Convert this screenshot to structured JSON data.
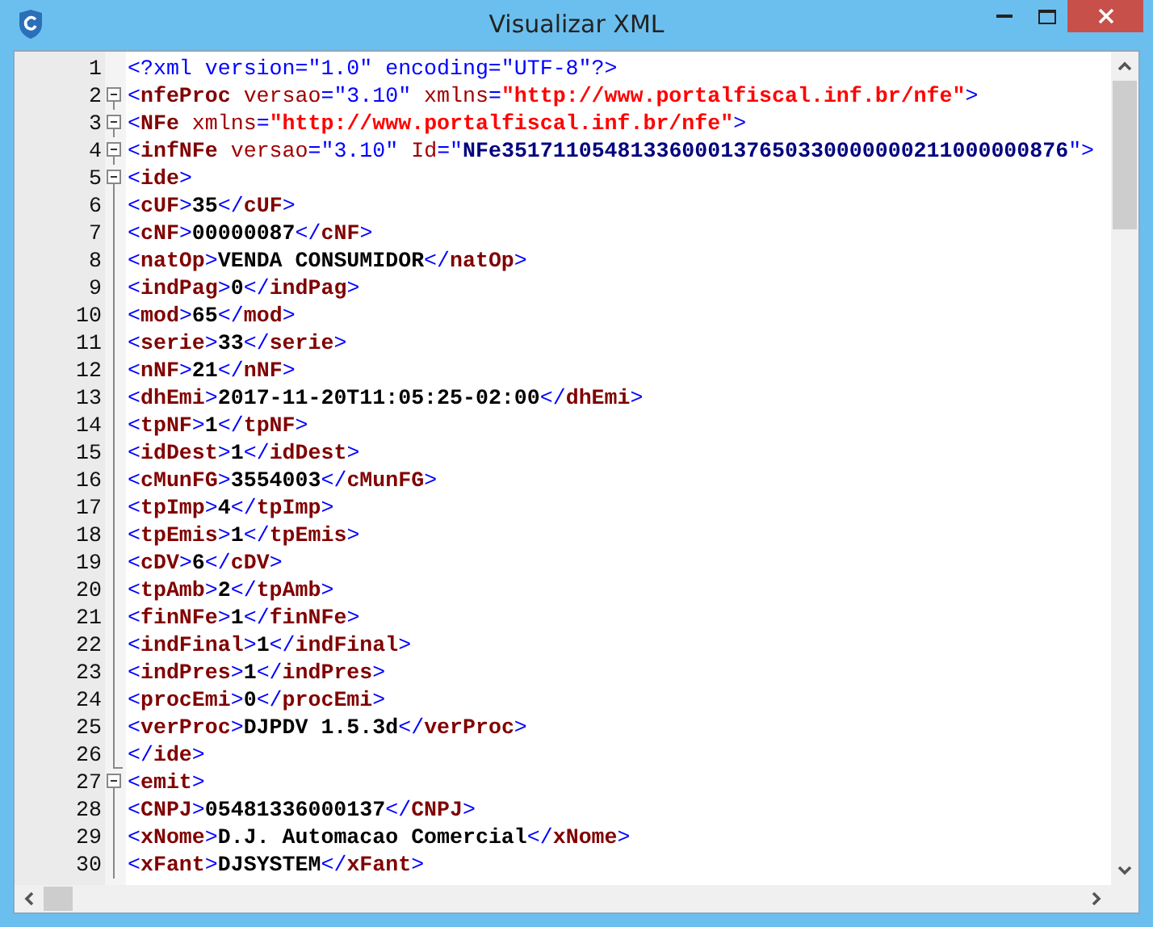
{
  "window": {
    "title": "Visualizar XML",
    "buttons": [
      {
        "kind": "minimize"
      },
      {
        "kind": "maximize"
      },
      {
        "kind": "close"
      }
    ]
  },
  "editor": {
    "lines": [
      {
        "number": "1",
        "kind": "plain",
        "tokens": [
          {
            "kind": "punct",
            "text": "<?xml version=\"1.0\" encoding=\"UTF-8\"?>"
          }
        ]
      },
      {
        "number": "2",
        "kind": "fold",
        "tokens": [
          {
            "kind": "punct",
            "text": "<"
          },
          {
            "kind": "tag",
            "text": "nfeProc"
          },
          {
            "kind": "attr",
            "text": " versao"
          },
          {
            "kind": "punct",
            "text": "="
          },
          {
            "kind": "value",
            "text": "\"3.10\""
          },
          {
            "kind": "attr",
            "text": " xmlns"
          },
          {
            "kind": "punct",
            "text": "="
          },
          {
            "kind": "url",
            "text": "\"http://www.portalfiscal.inf.br/nfe\""
          },
          {
            "kind": "punct",
            "text": ">"
          }
        ]
      },
      {
        "number": "3",
        "kind": "fold",
        "tokens": [
          {
            "kind": "punct",
            "text": "<"
          },
          {
            "kind": "tag",
            "text": "NFe"
          },
          {
            "kind": "attr",
            "text": " xmlns"
          },
          {
            "kind": "punct",
            "text": "="
          },
          {
            "kind": "url",
            "text": "\"http://www.portalfiscal.inf.br/nfe\""
          },
          {
            "kind": "punct",
            "text": ">"
          }
        ]
      },
      {
        "number": "4",
        "kind": "fold",
        "tokens": [
          {
            "kind": "punct",
            "text": "<"
          },
          {
            "kind": "tag",
            "text": "infNFe"
          },
          {
            "kind": "attr",
            "text": " versao"
          },
          {
            "kind": "punct",
            "text": "="
          },
          {
            "kind": "value",
            "text": "\"3.10\""
          },
          {
            "kind": "attr",
            "text": " Id"
          },
          {
            "kind": "punct",
            "text": "=\""
          },
          {
            "kind": "id",
            "text": "NFe35171105481336000137650330000000211000000876"
          },
          {
            "kind": "punct",
            "text": "\">"
          }
        ]
      },
      {
        "number": "5",
        "kind": "fold",
        "tokens": [
          {
            "kind": "punct",
            "text": "<"
          },
          {
            "kind": "tag",
            "text": "ide"
          },
          {
            "kind": "punct",
            "text": ">"
          }
        ]
      },
      {
        "number": "6",
        "kind": "body",
        "tokens": [
          {
            "kind": "punct",
            "text": "<"
          },
          {
            "kind": "tag",
            "text": "cUF"
          },
          {
            "kind": "punct",
            "text": ">"
          },
          {
            "kind": "text",
            "text": "35"
          },
          {
            "kind": "punct",
            "text": "</"
          },
          {
            "kind": "tag",
            "text": "cUF"
          },
          {
            "kind": "punct",
            "text": ">"
          }
        ]
      },
      {
        "number": "7",
        "kind": "body",
        "tokens": [
          {
            "kind": "punct",
            "text": "<"
          },
          {
            "kind": "tag",
            "text": "cNF"
          },
          {
            "kind": "punct",
            "text": ">"
          },
          {
            "kind": "text",
            "text": "00000087"
          },
          {
            "kind": "punct",
            "text": "</"
          },
          {
            "kind": "tag",
            "text": "cNF"
          },
          {
            "kind": "punct",
            "text": ">"
          }
        ]
      },
      {
        "number": "8",
        "kind": "body",
        "tokens": [
          {
            "kind": "punct",
            "text": "<"
          },
          {
            "kind": "tag",
            "text": "natOp"
          },
          {
            "kind": "punct",
            "text": ">"
          },
          {
            "kind": "text",
            "text": "VENDA CONSUMIDOR"
          },
          {
            "kind": "punct",
            "text": "</"
          },
          {
            "kind": "tag",
            "text": "natOp"
          },
          {
            "kind": "punct",
            "text": ">"
          }
        ]
      },
      {
        "number": "9",
        "kind": "body",
        "tokens": [
          {
            "kind": "punct",
            "text": "<"
          },
          {
            "kind": "tag",
            "text": "indPag"
          },
          {
            "kind": "punct",
            "text": ">"
          },
          {
            "kind": "text",
            "text": "0"
          },
          {
            "kind": "punct",
            "text": "</"
          },
          {
            "kind": "tag",
            "text": "indPag"
          },
          {
            "kind": "punct",
            "text": ">"
          }
        ]
      },
      {
        "number": "10",
        "kind": "body",
        "tokens": [
          {
            "kind": "punct",
            "text": "<"
          },
          {
            "kind": "tag",
            "text": "mod"
          },
          {
            "kind": "punct",
            "text": ">"
          },
          {
            "kind": "text",
            "text": "65"
          },
          {
            "kind": "punct",
            "text": "</"
          },
          {
            "kind": "tag",
            "text": "mod"
          },
          {
            "kind": "punct",
            "text": ">"
          }
        ]
      },
      {
        "number": "11",
        "kind": "body",
        "tokens": [
          {
            "kind": "punct",
            "text": "<"
          },
          {
            "kind": "tag",
            "text": "serie"
          },
          {
            "kind": "punct",
            "text": ">"
          },
          {
            "kind": "text",
            "text": "33"
          },
          {
            "kind": "punct",
            "text": "</"
          },
          {
            "kind": "tag",
            "text": "serie"
          },
          {
            "kind": "punct",
            "text": ">"
          }
        ]
      },
      {
        "number": "12",
        "kind": "body",
        "tokens": [
          {
            "kind": "punct",
            "text": "<"
          },
          {
            "kind": "tag",
            "text": "nNF"
          },
          {
            "kind": "punct",
            "text": ">"
          },
          {
            "kind": "text",
            "text": "21"
          },
          {
            "kind": "punct",
            "text": "</"
          },
          {
            "kind": "tag",
            "text": "nNF"
          },
          {
            "kind": "punct",
            "text": ">"
          }
        ]
      },
      {
        "number": "13",
        "kind": "body",
        "tokens": [
          {
            "kind": "punct",
            "text": "<"
          },
          {
            "kind": "tag",
            "text": "dhEmi"
          },
          {
            "kind": "punct",
            "text": ">"
          },
          {
            "kind": "text",
            "text": "2017-11-20T11:05:25-02:00"
          },
          {
            "kind": "punct",
            "text": "</"
          },
          {
            "kind": "tag",
            "text": "dhEmi"
          },
          {
            "kind": "punct",
            "text": ">"
          }
        ]
      },
      {
        "number": "14",
        "kind": "body",
        "tokens": [
          {
            "kind": "punct",
            "text": "<"
          },
          {
            "kind": "tag",
            "text": "tpNF"
          },
          {
            "kind": "punct",
            "text": ">"
          },
          {
            "kind": "text",
            "text": "1"
          },
          {
            "kind": "punct",
            "text": "</"
          },
          {
            "kind": "tag",
            "text": "tpNF"
          },
          {
            "kind": "punct",
            "text": ">"
          }
        ]
      },
      {
        "number": "15",
        "kind": "body",
        "tokens": [
          {
            "kind": "punct",
            "text": "<"
          },
          {
            "kind": "tag",
            "text": "idDest"
          },
          {
            "kind": "punct",
            "text": ">"
          },
          {
            "kind": "text",
            "text": "1"
          },
          {
            "kind": "punct",
            "text": "</"
          },
          {
            "kind": "tag",
            "text": "idDest"
          },
          {
            "kind": "punct",
            "text": ">"
          }
        ]
      },
      {
        "number": "16",
        "kind": "body",
        "tokens": [
          {
            "kind": "punct",
            "text": "<"
          },
          {
            "kind": "tag",
            "text": "cMunFG"
          },
          {
            "kind": "punct",
            "text": ">"
          },
          {
            "kind": "text",
            "text": "3554003"
          },
          {
            "kind": "punct",
            "text": "</"
          },
          {
            "kind": "tag",
            "text": "cMunFG"
          },
          {
            "kind": "punct",
            "text": ">"
          }
        ]
      },
      {
        "number": "17",
        "kind": "body",
        "tokens": [
          {
            "kind": "punct",
            "text": "<"
          },
          {
            "kind": "tag",
            "text": "tpImp"
          },
          {
            "kind": "punct",
            "text": ">"
          },
          {
            "kind": "text",
            "text": "4"
          },
          {
            "kind": "punct",
            "text": "</"
          },
          {
            "kind": "tag",
            "text": "tpImp"
          },
          {
            "kind": "punct",
            "text": ">"
          }
        ]
      },
      {
        "number": "18",
        "kind": "body",
        "tokens": [
          {
            "kind": "punct",
            "text": "<"
          },
          {
            "kind": "tag",
            "text": "tpEmis"
          },
          {
            "kind": "punct",
            "text": ">"
          },
          {
            "kind": "text",
            "text": "1"
          },
          {
            "kind": "punct",
            "text": "</"
          },
          {
            "kind": "tag",
            "text": "tpEmis"
          },
          {
            "kind": "punct",
            "text": ">"
          }
        ]
      },
      {
        "number": "19",
        "kind": "body",
        "tokens": [
          {
            "kind": "punct",
            "text": "<"
          },
          {
            "kind": "tag",
            "text": "cDV"
          },
          {
            "kind": "punct",
            "text": ">"
          },
          {
            "kind": "text",
            "text": "6"
          },
          {
            "kind": "punct",
            "text": "</"
          },
          {
            "kind": "tag",
            "text": "cDV"
          },
          {
            "kind": "punct",
            "text": ">"
          }
        ]
      },
      {
        "number": "20",
        "kind": "body",
        "tokens": [
          {
            "kind": "punct",
            "text": "<"
          },
          {
            "kind": "tag",
            "text": "tpAmb"
          },
          {
            "kind": "punct",
            "text": ">"
          },
          {
            "kind": "text",
            "text": "2"
          },
          {
            "kind": "punct",
            "text": "</"
          },
          {
            "kind": "tag",
            "text": "tpAmb"
          },
          {
            "kind": "punct",
            "text": ">"
          }
        ]
      },
      {
        "number": "21",
        "kind": "body",
        "tokens": [
          {
            "kind": "punct",
            "text": "<"
          },
          {
            "kind": "tag",
            "text": "finNFe"
          },
          {
            "kind": "punct",
            "text": ">"
          },
          {
            "kind": "text",
            "text": "1"
          },
          {
            "kind": "punct",
            "text": "</"
          },
          {
            "kind": "tag",
            "text": "finNFe"
          },
          {
            "kind": "punct",
            "text": ">"
          }
        ]
      },
      {
        "number": "22",
        "kind": "body",
        "tokens": [
          {
            "kind": "punct",
            "text": "<"
          },
          {
            "kind": "tag",
            "text": "indFinal"
          },
          {
            "kind": "punct",
            "text": ">"
          },
          {
            "kind": "text",
            "text": "1"
          },
          {
            "kind": "punct",
            "text": "</"
          },
          {
            "kind": "tag",
            "text": "indFinal"
          },
          {
            "kind": "punct",
            "text": ">"
          }
        ]
      },
      {
        "number": "23",
        "kind": "body",
        "tokens": [
          {
            "kind": "punct",
            "text": "<"
          },
          {
            "kind": "tag",
            "text": "indPres"
          },
          {
            "kind": "punct",
            "text": ">"
          },
          {
            "kind": "text",
            "text": "1"
          },
          {
            "kind": "punct",
            "text": "</"
          },
          {
            "kind": "tag",
            "text": "indPres"
          },
          {
            "kind": "punct",
            "text": ">"
          }
        ]
      },
      {
        "number": "24",
        "kind": "body",
        "tokens": [
          {
            "kind": "punct",
            "text": "<"
          },
          {
            "kind": "tag",
            "text": "procEmi"
          },
          {
            "kind": "punct",
            "text": ">"
          },
          {
            "kind": "text",
            "text": "0"
          },
          {
            "kind": "punct",
            "text": "</"
          },
          {
            "kind": "tag",
            "text": "procEmi"
          },
          {
            "kind": "punct",
            "text": ">"
          }
        ]
      },
      {
        "number": "25",
        "kind": "body",
        "tokens": [
          {
            "kind": "punct",
            "text": "<"
          },
          {
            "kind": "tag",
            "text": "verProc"
          },
          {
            "kind": "punct",
            "text": ">"
          },
          {
            "kind": "text",
            "text": "DJPDV 1.5.3d"
          },
          {
            "kind": "punct",
            "text": "</"
          },
          {
            "kind": "tag",
            "text": "verProc"
          },
          {
            "kind": "punct",
            "text": ">"
          }
        ]
      },
      {
        "number": "26",
        "kind": "end",
        "tokens": [
          {
            "kind": "punct",
            "text": "</"
          },
          {
            "kind": "tag",
            "text": "ide"
          },
          {
            "kind": "punct",
            "text": ">"
          }
        ]
      },
      {
        "number": "27",
        "kind": "fold",
        "tokens": [
          {
            "kind": "punct",
            "text": "<"
          },
          {
            "kind": "tag",
            "text": "emit"
          },
          {
            "kind": "punct",
            "text": ">"
          }
        ]
      },
      {
        "number": "28",
        "kind": "body",
        "tokens": [
          {
            "kind": "punct",
            "text": "<"
          },
          {
            "kind": "tag",
            "text": "CNPJ"
          },
          {
            "kind": "punct",
            "text": ">"
          },
          {
            "kind": "text",
            "text": "05481336000137"
          },
          {
            "kind": "punct",
            "text": "</"
          },
          {
            "kind": "tag",
            "text": "CNPJ"
          },
          {
            "kind": "punct",
            "text": ">"
          }
        ]
      },
      {
        "number": "29",
        "kind": "body",
        "tokens": [
          {
            "kind": "punct",
            "text": "<"
          },
          {
            "kind": "tag",
            "text": "xNome"
          },
          {
            "kind": "punct",
            "text": ">"
          },
          {
            "kind": "text",
            "text": "D.J. Automacao Comercial"
          },
          {
            "kind": "punct",
            "text": "</"
          },
          {
            "kind": "tag",
            "text": "xNome"
          },
          {
            "kind": "punct",
            "text": ">"
          }
        ]
      },
      {
        "number": "30",
        "kind": "body",
        "tokens": [
          {
            "kind": "punct",
            "text": "<"
          },
          {
            "kind": "tag",
            "text": "xFant"
          },
          {
            "kind": "punct",
            "text": ">"
          },
          {
            "kind": "text",
            "text": "DJSYSTEM"
          },
          {
            "kind": "punct",
            "text": "</"
          },
          {
            "kind": "tag",
            "text": "xFant"
          },
          {
            "kind": "punct",
            "text": ">"
          }
        ]
      }
    ]
  }
}
